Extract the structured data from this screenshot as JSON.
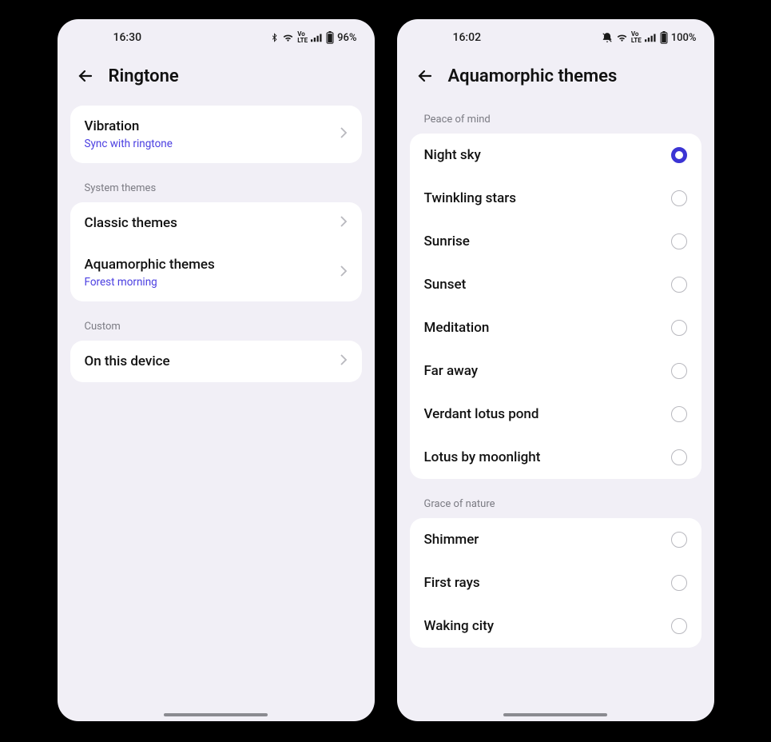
{
  "left": {
    "status": {
      "time": "16:30",
      "battery": "96%"
    },
    "title": "Ringtone",
    "vibration": {
      "title": "Vibration",
      "sub": "Sync with ringtone"
    },
    "section_system": "System themes",
    "classic": "Classic themes",
    "aqua": {
      "title": "Aquamorphic themes",
      "sub": "Forest morning"
    },
    "section_custom": "Custom",
    "device": "On this device"
  },
  "right": {
    "status": {
      "time": "16:02",
      "battery": "100%"
    },
    "title": "Aquamorphic themes",
    "group1_label": "Peace of mind",
    "group1": [
      {
        "label": "Night sky",
        "selected": true
      },
      {
        "label": "Twinkling stars",
        "selected": false
      },
      {
        "label": "Sunrise",
        "selected": false
      },
      {
        "label": "Sunset",
        "selected": false
      },
      {
        "label": "Meditation",
        "selected": false
      },
      {
        "label": "Far away",
        "selected": false
      },
      {
        "label": "Verdant lotus pond",
        "selected": false
      },
      {
        "label": "Lotus by moonlight",
        "selected": false
      }
    ],
    "group2_label": "Grace of nature",
    "group2": [
      {
        "label": "Shimmer",
        "selected": false
      },
      {
        "label": "First rays",
        "selected": false
      },
      {
        "label": "Waking city",
        "selected": false
      }
    ]
  }
}
